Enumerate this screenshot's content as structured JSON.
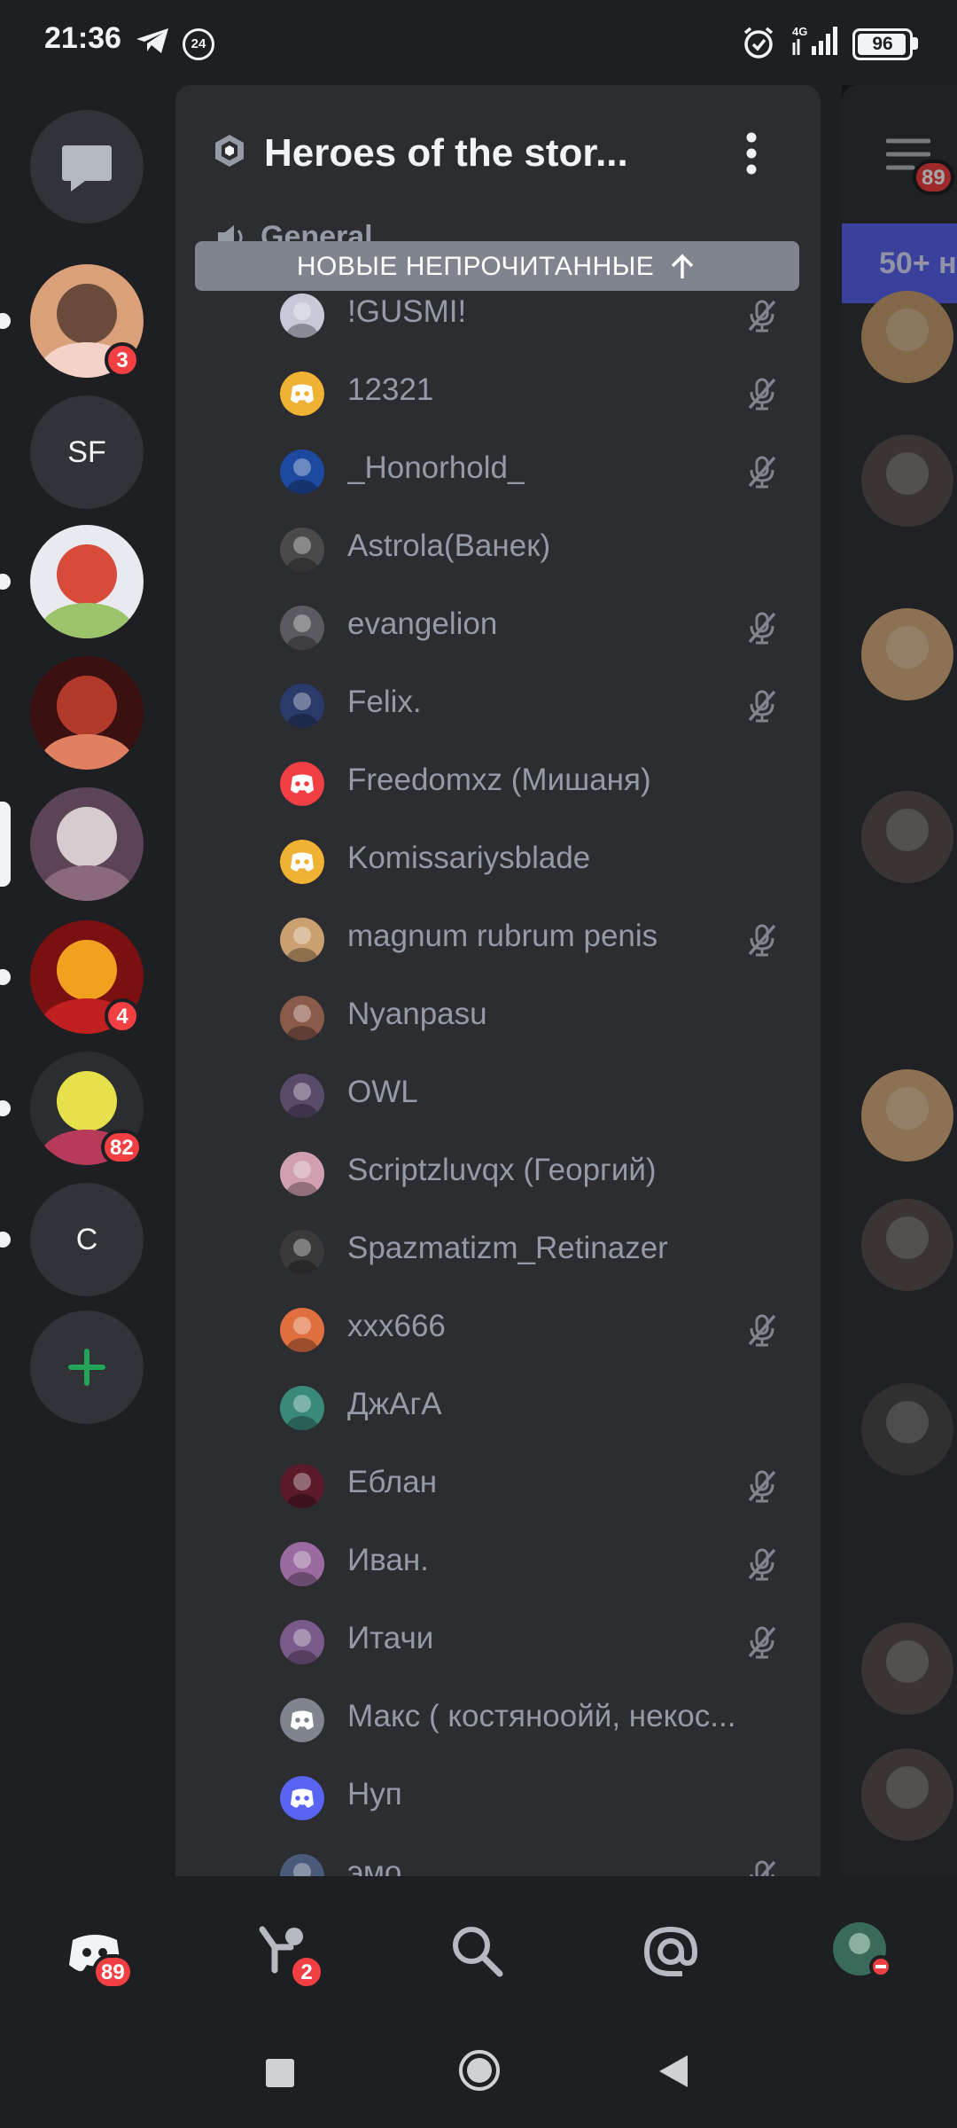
{
  "status_bar": {
    "time": "21:36",
    "notif_count": "24",
    "network": "4G",
    "battery": "96",
    "battery_level": 0.96
  },
  "servers": [
    {
      "kind": "dm",
      "name": "direct-messages",
      "icon": "chat-bubble-icon"
    },
    {
      "kind": "image",
      "name": "anime-girl-avatar",
      "unread": true,
      "badge": "3",
      "colors": [
        "#d9a07a",
        "#6a4a3a",
        "#f4d2c8"
      ]
    },
    {
      "kind": "initials",
      "name": "server-sf",
      "text": "SF"
    },
    {
      "kind": "image",
      "name": "cartoon-avatar",
      "unread": true,
      "colors": [
        "#e9e9f0",
        "#d84a3a",
        "#9bc46a"
      ]
    },
    {
      "kind": "image",
      "name": "horde-emblem",
      "colors": [
        "#3a1010",
        "#b33a2a",
        "#e08060"
      ]
    },
    {
      "kind": "image",
      "name": "white-tiger",
      "active": true,
      "colors": [
        "#5a4456",
        "#d8cbd0",
        "#8a6a7a"
      ]
    },
    {
      "kind": "image",
      "name": "wow-circle",
      "unread": true,
      "badge": "4",
      "colors": [
        "#7a1010",
        "#f2a020",
        "#c02020"
      ]
    },
    {
      "kind": "image",
      "name": "yellow-caterpillar",
      "unread": true,
      "badge": "82",
      "colors": [
        "#2b2d31",
        "#e6e04a",
        "#b83a5a"
      ]
    },
    {
      "kind": "initials",
      "name": "server-c",
      "text": "C",
      "unread": true
    },
    {
      "kind": "add",
      "name": "add-server",
      "icon": "plus-icon",
      "color": "#23a559"
    }
  ],
  "panel": {
    "title": "Heroes of the stor...",
    "category": "General",
    "unread_banner": "НОВЫЕ НЕПРОЧИТАННЫЕ",
    "members": [
      {
        "name": "!GUSMI!",
        "muted": true,
        "avatar": "photo",
        "color": "#c8c8d8"
      },
      {
        "name": "12321",
        "muted": true,
        "avatar": "discord",
        "color": "#f0b232"
      },
      {
        "name": "_Honorhold_",
        "muted": true,
        "avatar": "photo",
        "color": "#1d4aa0"
      },
      {
        "name": "Astrola(Ванек)",
        "muted": false,
        "avatar": "photo",
        "color": "#4a4a4a"
      },
      {
        "name": "evangelion",
        "muted": true,
        "avatar": "photo",
        "color": "#5a5a60"
      },
      {
        "name": "Felix.",
        "muted": true,
        "avatar": "photo",
        "color": "#2a3a6a"
      },
      {
        "name": "Freedomxz (Мишаня)",
        "muted": false,
        "avatar": "discord",
        "color": "#f23f43"
      },
      {
        "name": "Komissariysblade",
        "muted": false,
        "avatar": "discord",
        "color": "#f0b232"
      },
      {
        "name": "magnum rubrum penis",
        "muted": true,
        "avatar": "photo",
        "color": "#caa070"
      },
      {
        "name": "Nyanpasu",
        "muted": false,
        "avatar": "photo",
        "color": "#8a5a4a"
      },
      {
        "name": "OWL",
        "muted": false,
        "avatar": "photo",
        "color": "#5a4a6a"
      },
      {
        "name": "Scriptzluvqx (Георгий)",
        "muted": false,
        "avatar": "photo",
        "color": "#d0a0b0"
      },
      {
        "name": "Spazmatizm_Retinazer",
        "muted": false,
        "avatar": "photo",
        "color": "#3a3a3a"
      },
      {
        "name": "xxx666",
        "muted": true,
        "avatar": "photo",
        "color": "#e07040"
      },
      {
        "name": "ДжАгА",
        "muted": false,
        "avatar": "photo",
        "color": "#3a8a7a"
      },
      {
        "name": "Еблан",
        "muted": true,
        "avatar": "photo",
        "color": "#5a1a2a"
      },
      {
        "name": "Иван.",
        "muted": true,
        "avatar": "photo",
        "color": "#9a6aa0"
      },
      {
        "name": "Итачи",
        "muted": true,
        "avatar": "photo",
        "color": "#7a5a8a"
      },
      {
        "name": "Макс ( костяноойй, некос...",
        "muted": false,
        "avatar": "discord",
        "color": "#80848e"
      },
      {
        "name": "Нуп",
        "muted": false,
        "avatar": "discord",
        "color": "#5865f2"
      },
      {
        "name": "эмо",
        "muted": true,
        "avatar": "photo",
        "color": "#4a5a7a"
      }
    ]
  },
  "chat_preview": {
    "menu_badge": "89",
    "new_messages": "50+ н"
  },
  "tabs": [
    {
      "name": "home",
      "icon": "discord-home-icon",
      "badge": "89"
    },
    {
      "name": "friends",
      "icon": "friends-wave-icon",
      "badge": "2"
    },
    {
      "name": "search",
      "icon": "search-icon"
    },
    {
      "name": "mentions",
      "icon": "at-sign-icon"
    },
    {
      "name": "profile",
      "icon": "avatar-dnd-icon"
    }
  ],
  "colors": {
    "background": "#1e1f22",
    "panel": "#2b2d31",
    "chat": "#313338",
    "accent": "#5865f2",
    "badge": "#f23f43",
    "muted_text": "#949ba4"
  }
}
